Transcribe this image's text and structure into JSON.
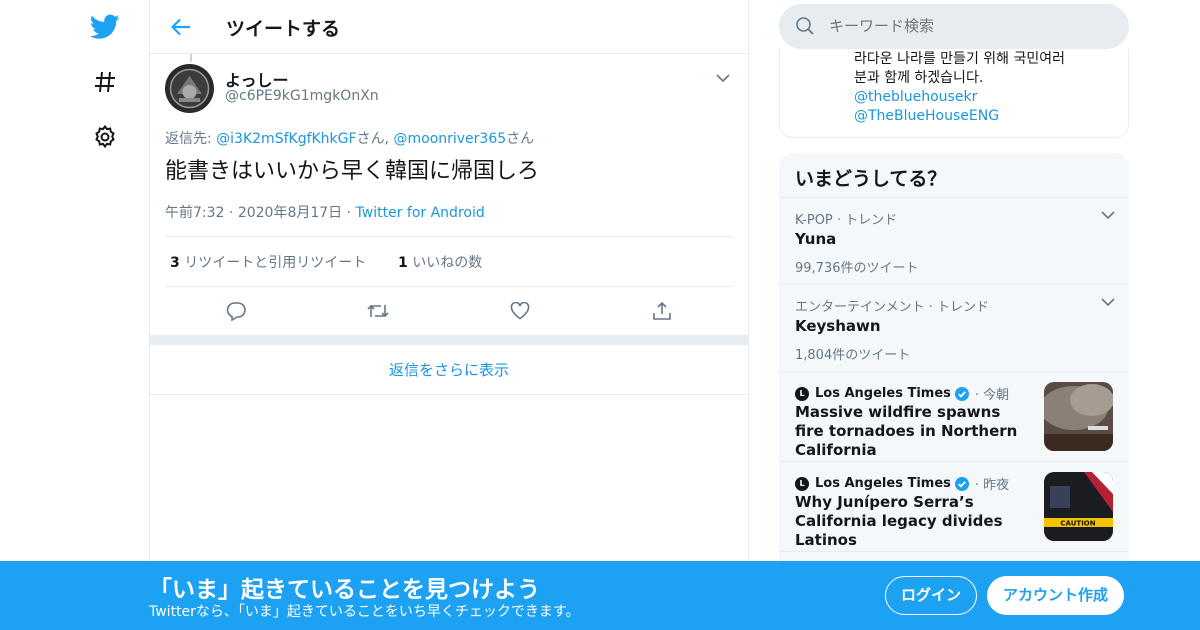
{
  "colors": {
    "brand": "#1da1f2",
    "link": "#1b95e0",
    "muted": "#657786",
    "border": "#e6ecf0"
  },
  "nav": {
    "items": [
      {
        "icon": "twitter-bird-icon"
      },
      {
        "icon": "hashtag-icon"
      },
      {
        "icon": "gear-icon"
      }
    ]
  },
  "header": {
    "title": "ツイートする"
  },
  "tweet": {
    "display_name": "よっしー",
    "handle": "@c6PE9kG1mgkOnXn",
    "reply_prefix": "返信先: ",
    "reply_to": [
      {
        "user": "@i3K2mSfKgfKhkGF",
        "suffix": "さん,"
      },
      {
        "user": "@moonriver365",
        "suffix": "さん"
      }
    ],
    "text": "能書きはいいから早く韓国に帰国しろ",
    "time": "午前7:32",
    "date": "2020年8月17日",
    "client": "Twitter for Android",
    "separator": "·",
    "retweets_count": "3",
    "retweets_label": "リツイートと引用リツイート",
    "likes_count": "1",
    "likes_label": "いいねの数"
  },
  "show_more": "返信をさらに表示",
  "search": {
    "placeholder": "キーワード検索"
  },
  "embed": {
    "lines": [
      "라다운 나라를 만들기 위해 국민여러",
      "분과 함께 하겠습니다."
    ],
    "links": [
      "@thebluehousekr",
      "@TheBlueHouseENG"
    ]
  },
  "trends": {
    "title": "いまどうしてる？",
    "items": [
      {
        "category": "K-POP · トレンド",
        "name": "Yuna",
        "count": "99,736件のツイート"
      },
      {
        "category": "エンターテインメント · トレンド",
        "name": "Keyshawn",
        "count": "1,804件のツイート"
      }
    ],
    "news": [
      {
        "source": "Los Angeles Times",
        "when": "· 今朝",
        "title": "Massive wildfire spawns fire tornadoes in Northern California",
        "thumb": "wildfire-smoke-photo"
      },
      {
        "source": "Los Angeles Times",
        "when": "· 昨夜",
        "title": "Why Junípero Serra’s California legacy divides Latinos",
        "thumb": "caution-tape-flag-photo",
        "thumb_text": "CAUTION"
      }
    ]
  },
  "banner": {
    "title": "「いま」起きていることを見つけよう",
    "subtitle": "Twitterなら、「いま」起きていることをいち早くチェックできます。",
    "login": "ログイン",
    "signup": "アカウント作成"
  }
}
